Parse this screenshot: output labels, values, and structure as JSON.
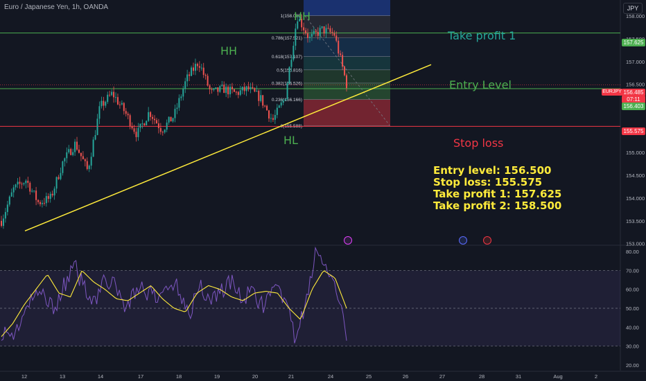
{
  "title": "Euro / Japanese Yen, 1h, OANDA",
  "currency": "JPY",
  "symbol": "EURJPY",
  "colors": {
    "background": "#131722",
    "up": "#26a69a",
    "down": "#ef5350",
    "trendline": "#ffeb3b",
    "rsi": "#7e57c2",
    "rsi_ma": "#ffeb3b",
    "takeprofit": "#26a69a",
    "stoploss": "#f23645",
    "entry_line": "#4caf50"
  },
  "annotations": {
    "hh1": "HH",
    "hh2": "HH",
    "hl": "HL",
    "take_profit": "Take profit 1",
    "entry": "Entry Level",
    "stop_loss": "Stop loss"
  },
  "info_lines": [
    "Entry level: 156.500",
    "Stop loss: 155.575",
    "Take profit 1: 157.625",
    "Take profit 2: 158.500"
  ],
  "price_tags": [
    {
      "text": "157.625",
      "color": "#4caf50"
    },
    {
      "text": "156.485",
      "color": "#f23645"
    },
    {
      "text": "07:11",
      "color": "#f23645"
    },
    {
      "text": "156.403",
      "color": "#4caf50"
    },
    {
      "text": "155.575",
      "color": "#f23645"
    }
  ],
  "chart_data": [
    {
      "type": "line",
      "name": "price",
      "ylim": [
        152.95,
        158.35
      ],
      "y_ticks": [
        "153.000",
        "153.500",
        "154.000",
        "154.500",
        "155.000",
        "155.500",
        "156.000",
        "156.500",
        "157.000",
        "157.500",
        "158.000"
      ],
      "x_ticks": [
        "12",
        "13",
        "14",
        "17",
        "18",
        "19",
        "20",
        "21",
        "24",
        "25",
        "26",
        "27",
        "28",
        "31",
        "Aug",
        "2"
      ],
      "fib_levels": [
        {
          "ratio": "1",
          "price": 158.005,
          "label": "1(158.005)"
        },
        {
          "ratio": "0.786",
          "price": 157.521,
          "label": "0.786(157.521)"
        },
        {
          "ratio": "0.618",
          "price": 157.107,
          "label": "0.618(157.107)"
        },
        {
          "ratio": "0.5",
          "price": 156.816,
          "label": "0.5(156.816)"
        },
        {
          "ratio": "0.382",
          "price": 156.526,
          "label": "0.382(156.526)"
        },
        {
          "ratio": "0.236",
          "price": 156.166,
          "label": "0.236(156.166)"
        },
        {
          "ratio": "0",
          "price": 155.588,
          "label": "0(155.588)"
        }
      ],
      "horizontal_lines": {
        "take_profit_1": 157.625,
        "entry": 156.403,
        "stop_loss": 155.575
      },
      "trendline": [
        [
          153.28,
          "Jul 12"
        ],
        [
          156.93,
          "Jul 25"
        ]
      ],
      "close_path": [
        153.5,
        154.2,
        154.4,
        153.9,
        154.0,
        154.8,
        155.2,
        154.6,
        156.0,
        156.3,
        155.9,
        155.4,
        155.9,
        155.5,
        155.8,
        156.6,
        157.0,
        156.3,
        156.4,
        156.3,
        156.4,
        156.2,
        155.7,
        156.2,
        158.0,
        157.5,
        157.7,
        157.6,
        156.5
      ]
    },
    {
      "type": "line",
      "name": "RSI",
      "ylim": [
        17,
        83
      ],
      "y_ticks": [
        "80.00",
        "70.00",
        "60.00",
        "50.00",
        "40.00",
        "30.00",
        "20.00"
      ],
      "bands": [
        30,
        50,
        70
      ],
      "values": [
        38,
        35,
        45,
        55,
        58,
        50,
        62,
        72,
        60,
        55,
        66,
        60,
        50,
        62,
        58,
        54,
        64,
        60,
        48,
        62,
        54,
        60,
        64,
        55,
        58,
        52,
        58,
        57,
        35,
        48,
        80,
        72,
        58,
        35
      ],
      "ma_values": [
        35,
        42,
        52,
        60,
        68,
        58,
        56,
        70,
        64,
        60,
        55,
        54,
        58,
        62,
        55,
        50,
        48,
        58,
        62,
        60,
        56,
        54,
        58,
        59,
        58,
        50,
        44,
        60,
        70,
        66,
        50
      ]
    }
  ]
}
